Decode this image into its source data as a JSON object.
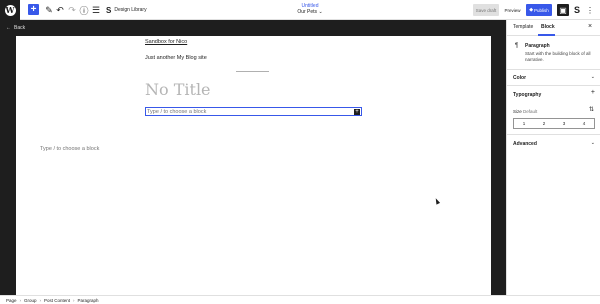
{
  "toolbar": {
    "logo_letter": "W",
    "add_symbol": "+",
    "edit_symbol": "✎",
    "undo_symbol": "↶",
    "redo_symbol": "↷",
    "info_symbol": "ⓘ",
    "list_symbol": "☰",
    "design_library_icon": "S",
    "design_library_label": "Design Library",
    "doc_title": "Untitled",
    "doc_subtitle": "Our Pets",
    "doc_chevron": "⌄",
    "save_draft_label": "Save draft",
    "preview_label": "Preview",
    "publish_label": "Publish",
    "settings_symbol": "▣",
    "plugin_symbol": "S",
    "more_symbol": "⋮"
  },
  "canvas": {
    "back_label": "Back",
    "back_arrow": "←",
    "site_title": "Sandbox for Nico",
    "site_tagline": "Just another My Blog site",
    "post_title_placeholder": "No Title",
    "block_placeholder": "Type / to choose a block",
    "block_plus": "+",
    "outer_placeholder": "Type / to choose a block"
  },
  "sidebar": {
    "tab_template": "Template",
    "tab_block": "Block",
    "close_symbol": "×",
    "block_icon": "¶",
    "block_name": "Paragraph",
    "block_description": "Start with the building block of all narrative.",
    "color_label": "Color",
    "typography_label": "Typography",
    "typography_add": "+",
    "size_label": "Size",
    "size_value": "Default",
    "size_control_icon": "⇅",
    "size_options": [
      "1",
      "2",
      "3",
      "4"
    ],
    "advanced_label": "Advanced",
    "chevron": "⌄"
  },
  "breadcrumb": {
    "items": [
      "Page",
      "Group",
      "Post Content",
      "Paragraph"
    ],
    "separator": "›"
  },
  "colors": {
    "accent": "#3858e9",
    "canvas_bg": "#1e1e1e"
  }
}
